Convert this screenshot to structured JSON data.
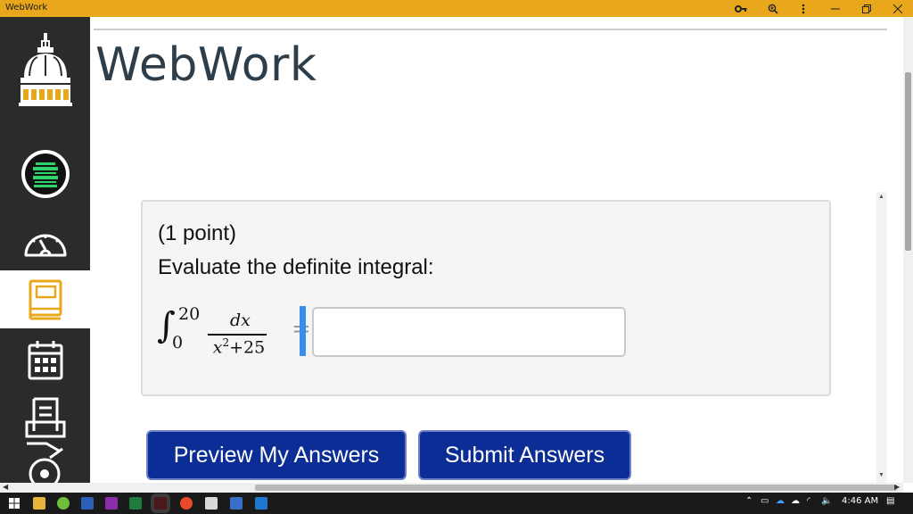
{
  "window": {
    "title": "WebWork",
    "controls": [
      "key-icon",
      "zoom-icon",
      "more-icon",
      "minimize-icon",
      "restore-icon",
      "close-icon"
    ]
  },
  "sidebar": {
    "items": [
      {
        "name": "university-dome-logo",
        "active": false
      },
      {
        "name": "motivation-badge",
        "active": false
      },
      {
        "name": "dashboard",
        "active": false
      },
      {
        "name": "courses",
        "active": true
      },
      {
        "name": "calendar",
        "active": false
      },
      {
        "name": "inbox",
        "active": false
      }
    ],
    "accent": "#e9a81c",
    "background": "#2b2b2b"
  },
  "page": {
    "title": "WebWork"
  },
  "problem": {
    "points": "(1 point)",
    "prompt": "Evaluate the definite integral:",
    "integral": {
      "upper": "20",
      "lower": "0",
      "numerator": "dx",
      "denominator_var": "x",
      "denominator_exp": "2",
      "denominator_rest": "+25",
      "equals": "="
    },
    "answer_value": ""
  },
  "buttons": {
    "preview": "Preview My Answers",
    "submit": "Submit Answers"
  },
  "colors": {
    "button_bg": "#0d2d96",
    "focus_bar": "#3a8de8",
    "title_bar": "#e9a81c"
  },
  "taskbar": {
    "time": "4:46 AM"
  }
}
